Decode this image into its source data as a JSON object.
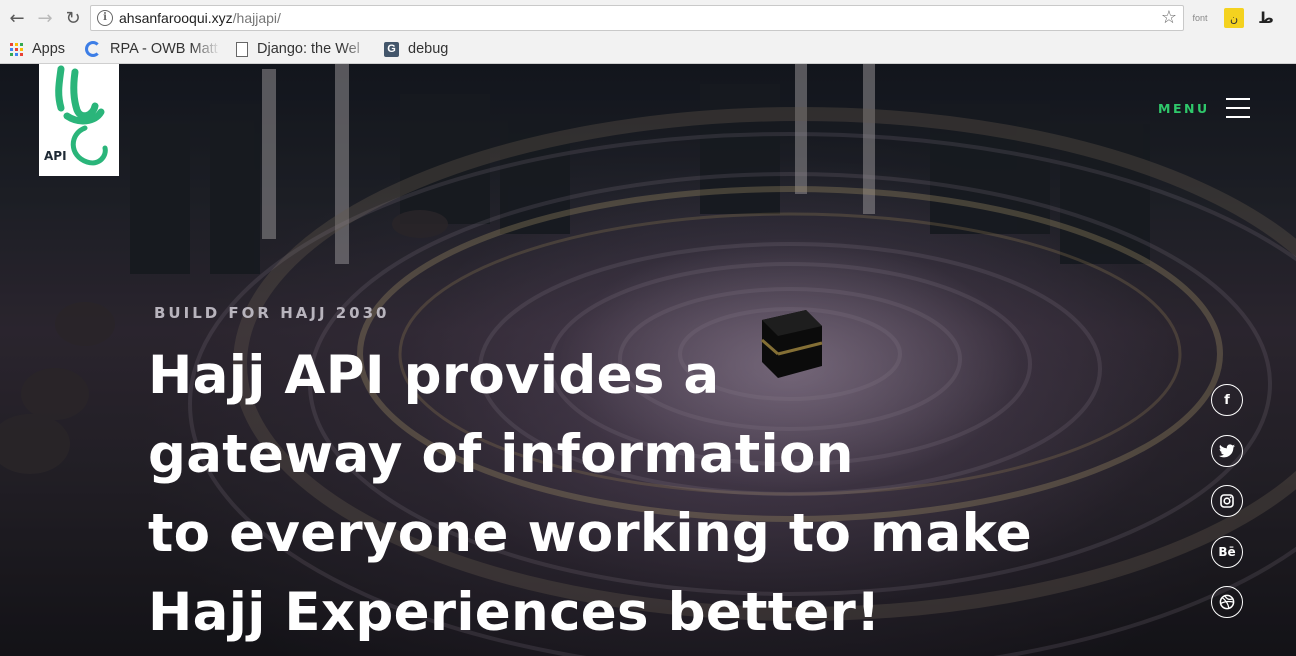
{
  "browser": {
    "nav": {
      "back_icon": "back-arrow-icon",
      "forward_icon": "forward-arrow-icon",
      "reload_icon": "reload-icon"
    },
    "url_host": "ahsanfarooqui.xyz",
    "url_path": "/hajjapi/",
    "extensions": {
      "font_label": "font",
      "yellow_label": "ن",
      "arabic_label": "ط"
    },
    "bookmarks": [
      {
        "label": "Apps",
        "icon": "apps-grid-icon"
      },
      {
        "label": "RPA - OWB Matt",
        "icon": "rpa-icon"
      },
      {
        "label": "Django: the Wel",
        "icon": "page-icon"
      },
      {
        "label": "debug",
        "icon": "g-icon"
      }
    ]
  },
  "site": {
    "logo_text": "API",
    "menu_label": "MENU",
    "eyebrow": "BUILD FOR HAJJ 2030",
    "headline_lines": [
      "Hajj API provides a",
      "gateway of information",
      "to everyone working to make",
      "Hajj Experiences better!"
    ],
    "social": [
      {
        "name": "facebook",
        "glyph": "f"
      },
      {
        "name": "twitter",
        "glyph": ""
      },
      {
        "name": "instagram",
        "glyph": ""
      },
      {
        "name": "behance",
        "glyph": "Bē"
      },
      {
        "name": "dribbble",
        "glyph": ""
      }
    ],
    "colors": {
      "menu_accent": "#2fc86b",
      "logo_green": "#2ab57a"
    }
  }
}
